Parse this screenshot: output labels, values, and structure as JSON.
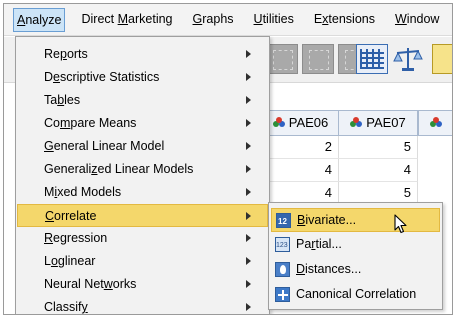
{
  "menubar": {
    "items": [
      {
        "pre": "",
        "u": "A",
        "post": "nalyze"
      },
      {
        "pre": "Direct ",
        "u": "M",
        "post": "arketing"
      },
      {
        "pre": "",
        "u": "G",
        "post": "raphs"
      },
      {
        "pre": "",
        "u": "U",
        "post": "tilities"
      },
      {
        "pre": "E",
        "u": "x",
        "post": "tensions"
      },
      {
        "pre": "",
        "u": "W",
        "post": "indow"
      }
    ]
  },
  "grid": {
    "columns": [
      "PAE06",
      "PAE07"
    ],
    "rows": [
      [
        "2",
        "5"
      ],
      [
        "4",
        "4"
      ],
      [
        "4",
        "5"
      ]
    ]
  },
  "analyze_menu": {
    "items": [
      {
        "pre": "Re",
        "u": "p",
        "post": "orts"
      },
      {
        "pre": "D",
        "u": "e",
        "post": "scriptive Statistics"
      },
      {
        "pre": "Ta",
        "u": "b",
        "post": "les"
      },
      {
        "pre": "Co",
        "u": "m",
        "post": "pare Means"
      },
      {
        "pre": "",
        "u": "G",
        "post": "eneral Linear Model"
      },
      {
        "pre": "Generali",
        "u": "z",
        "post": "ed Linear Models"
      },
      {
        "pre": "M",
        "u": "i",
        "post": "xed Models"
      },
      {
        "pre": "",
        "u": "C",
        "post": "orrelate"
      },
      {
        "pre": "",
        "u": "R",
        "post": "egression"
      },
      {
        "pre": "L",
        "u": "o",
        "post": "glinear"
      },
      {
        "pre": "Neural Net",
        "u": "w",
        "post": "orks"
      },
      {
        "pre": "Classif",
        "u": "y",
        "post": ""
      }
    ]
  },
  "correlate_submenu": {
    "items": [
      {
        "pre": "",
        "u": "B",
        "post": "ivariate..."
      },
      {
        "pre": "Pa",
        "u": "r",
        "post": "tial..."
      },
      {
        "pre": "",
        "u": "D",
        "post": "istances..."
      },
      {
        "pre": "Canonical Correlation",
        "u": "",
        "post": ""
      }
    ]
  },
  "colors": {
    "highlight": "#f4d76b",
    "menubar_active": "#cce4f7",
    "menu_bg": "#f2f2f2"
  }
}
